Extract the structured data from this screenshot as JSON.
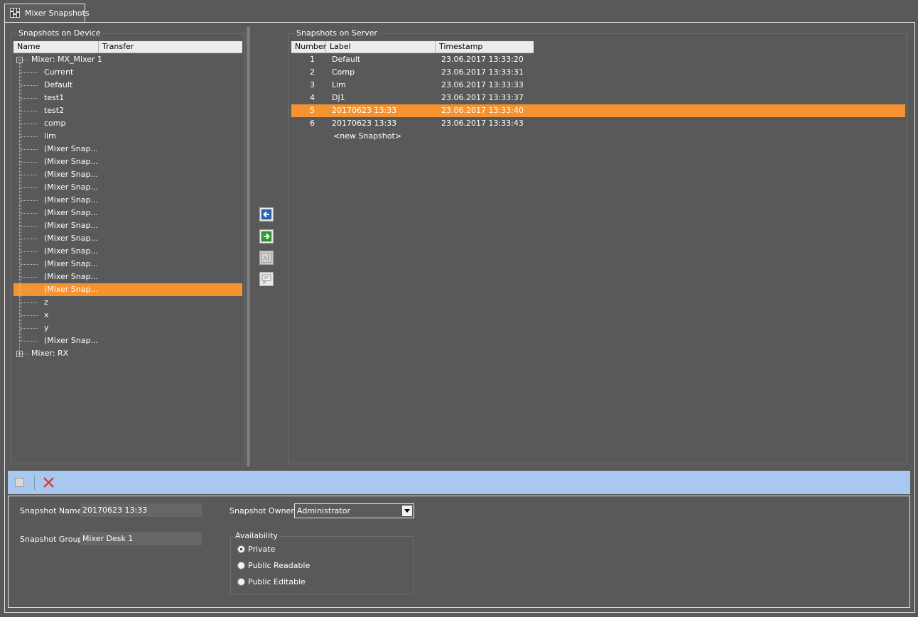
{
  "tab": {
    "title": "Mixer Snapshots",
    "icon": "mixer-faders-icon"
  },
  "device_panel": {
    "title": "Snapshots on Device",
    "columns": [
      "Name",
      "Transfer"
    ],
    "tree": [
      {
        "label": "Mixer: MX_Mixer 1",
        "level": 0,
        "expanded": true,
        "children": [
          "Current",
          "Default",
          "test1",
          "test2",
          "comp",
          "lim",
          "(Mixer Snap...",
          "(Mixer Snap...",
          "(Mixer Snap...",
          "(Mixer Snap...",
          "(Mixer Snap...",
          "(Mixer Snap...",
          "(Mixer Snap...",
          "(Mixer Snap...",
          "(Mixer Snap...",
          "(Mixer Snap...",
          "(Mixer Snap...",
          "(Mixer Snap...",
          "z",
          "x",
          "y",
          "(Mixer Snap..."
        ]
      },
      {
        "label": "Mixer: RX",
        "level": 0,
        "expanded": false,
        "children": []
      }
    ],
    "selected_child_index": 17
  },
  "transfer_buttons": [
    {
      "name": "transfer-to-device-button",
      "icon": "arrow-left-icon"
    },
    {
      "name": "transfer-to-server-button",
      "icon": "arrow-right-icon"
    },
    {
      "name": "rename-button",
      "icon": "text-edit-icon"
    },
    {
      "name": "comment-button",
      "icon": "comment-icon"
    }
  ],
  "server_panel": {
    "title": "Snapshots on Server",
    "columns": [
      "Number",
      "Label",
      "Timestamp"
    ],
    "rows": [
      {
        "number": "1",
        "label": "Default",
        "timestamp": "23.06.2017 13:33:20"
      },
      {
        "number": "2",
        "label": "Comp",
        "timestamp": "23.06.2017 13:33:31"
      },
      {
        "number": "3",
        "label": "Lim",
        "timestamp": "23.06.2017 13:33:33"
      },
      {
        "number": "4",
        "label": "DJ1",
        "timestamp": "23.06.2017 13:33:37"
      },
      {
        "number": "5",
        "label": "20170623 13:33",
        "timestamp": "23.06.2017 13:33:40"
      },
      {
        "number": "6",
        "label": "20170623 13:33",
        "timestamp": "23.06.2017 13:33:43"
      }
    ],
    "new_row_label": "<new Snapshot>",
    "selected_row_index": 4
  },
  "toolbar": {
    "stop_icon": "stop-icon",
    "delete_icon": "delete-x-icon"
  },
  "details": {
    "name_label": "Snapshot Name:",
    "name_value": "20170623 13:33",
    "group_label": "Snapshot Group:",
    "group_value": "Mixer Desk 1",
    "owner_label": "Snapshot Owner:",
    "owner_value": "Administrator",
    "availability_title": "Availability",
    "availability_options": [
      "Private",
      "Public Readable",
      "Public Editable"
    ],
    "availability_selected": "Private"
  },
  "colors": {
    "background": "#595959",
    "selection": "#f59330",
    "toolbar": "#a9c8ef",
    "header": "#ececec"
  }
}
